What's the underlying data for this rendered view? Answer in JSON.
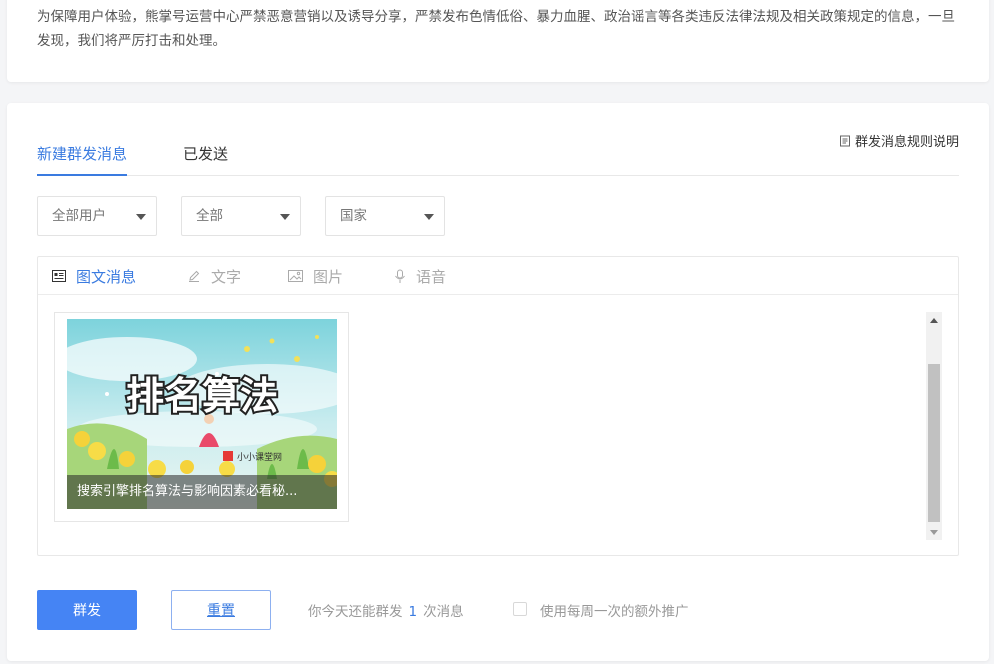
{
  "notice": {
    "text": "为保障用户体验，熊掌号运营中心严禁恶意营销以及诱导分享，严禁发布色情低俗、暴力血腥、政治谣言等各类违反法律法规及相关政策规定的信息，一旦发现，我们将严厉打击和处理。"
  },
  "tabs": {
    "new_label": "新建群发消息",
    "sent_label": "已发送"
  },
  "rules_link": "群发消息规则说明",
  "filters": [
    {
      "value": "全部用户"
    },
    {
      "value": "全部"
    },
    {
      "value": "国家"
    }
  ],
  "content_types": [
    {
      "label": "图文消息",
      "icon": "article-icon",
      "active": true
    },
    {
      "label": "文字",
      "icon": "pencil-icon",
      "active": false
    },
    {
      "label": "图片",
      "icon": "image-icon",
      "active": false
    },
    {
      "label": "语音",
      "icon": "microphone-icon",
      "active": false
    }
  ],
  "article": {
    "cover_text": "排名算法",
    "watermark": "小小课堂网",
    "title": "搜索引擎排名算法与影响因素必看秘..."
  },
  "actions": {
    "send_label": "群发",
    "reset_label": "重置"
  },
  "quota": {
    "prefix": "你今天还能群发",
    "count": "1",
    "suffix": "次消息"
  },
  "weekly_promo_label": "使用每周一次的额外推广",
  "colors": {
    "accent": "#3a7be0",
    "primary_button": "#4584f4"
  }
}
